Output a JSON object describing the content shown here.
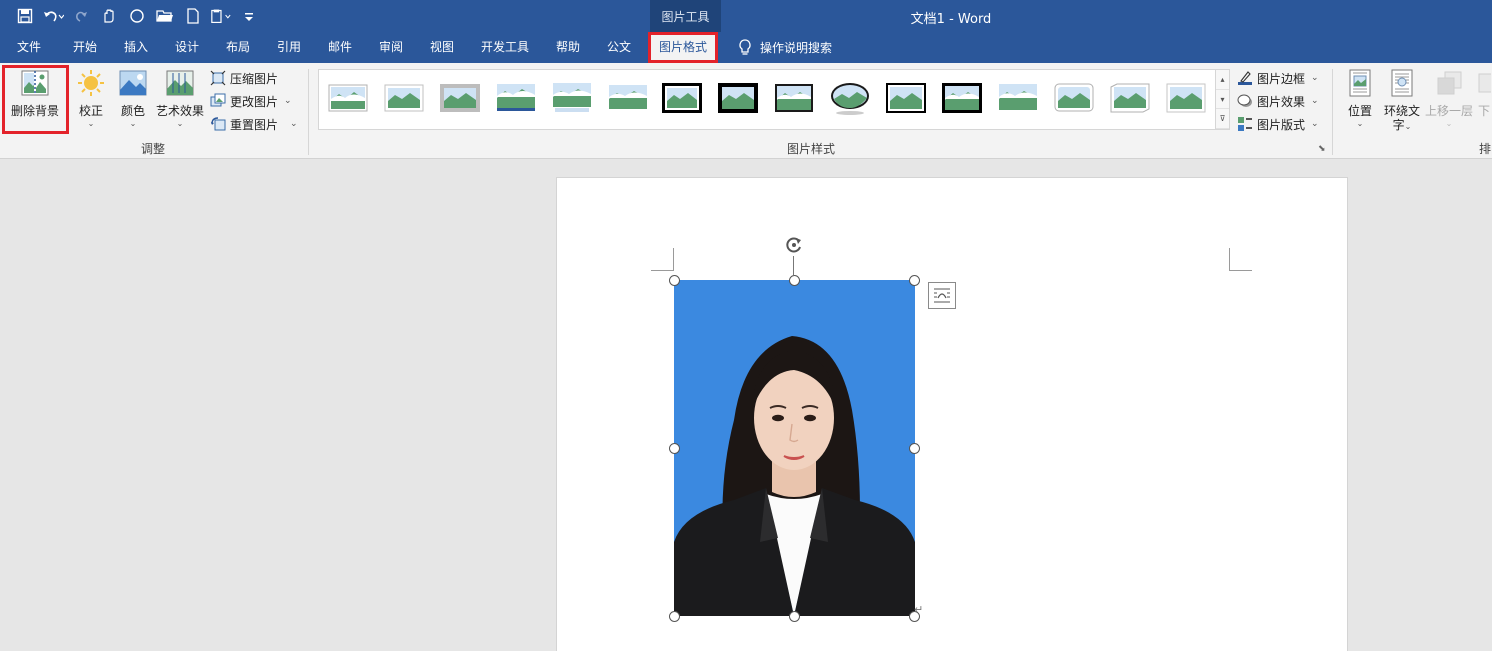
{
  "window": {
    "title": "文档1  -  Word",
    "context_tools_label": "图片工具"
  },
  "qat": {
    "icons": [
      "save-icon",
      "undo-icon",
      "redo-icon",
      "touch-mode-icon",
      "shape-icon",
      "open-icon",
      "new-icon",
      "paste-icon",
      "customize-icon"
    ]
  },
  "tabs": [
    {
      "label": "文件"
    },
    {
      "label": "开始"
    },
    {
      "label": "插入"
    },
    {
      "label": "设计"
    },
    {
      "label": "布局"
    },
    {
      "label": "引用"
    },
    {
      "label": "邮件"
    },
    {
      "label": "审阅"
    },
    {
      "label": "视图"
    },
    {
      "label": "开发工具"
    },
    {
      "label": "帮助"
    },
    {
      "label": "公文"
    },
    {
      "label": "图片格式",
      "active": true
    }
  ],
  "tell_me": "操作说明搜索",
  "ribbon": {
    "adjust": {
      "remove_bg": "删除背景",
      "corrections": "校正",
      "color": "颜色",
      "artistic": "艺术效果",
      "compress": "压缩图片",
      "change": "更改图片",
      "reset": "重置图片",
      "group_label": "调整"
    },
    "styles": {
      "group_label": "图片样式",
      "border": "图片边框",
      "effects": "图片效果",
      "layout": "图片版式"
    },
    "arrange": {
      "position": "位置",
      "wrap_l1": "环绕文",
      "wrap_l2": "字",
      "bring_forward": "上移一层",
      "send_back": "下",
      "group_label": "排"
    }
  },
  "colors": {
    "title_bar": "#2b579a",
    "highlight_border": "#e3222a",
    "photo_background": "#3b89e0"
  }
}
